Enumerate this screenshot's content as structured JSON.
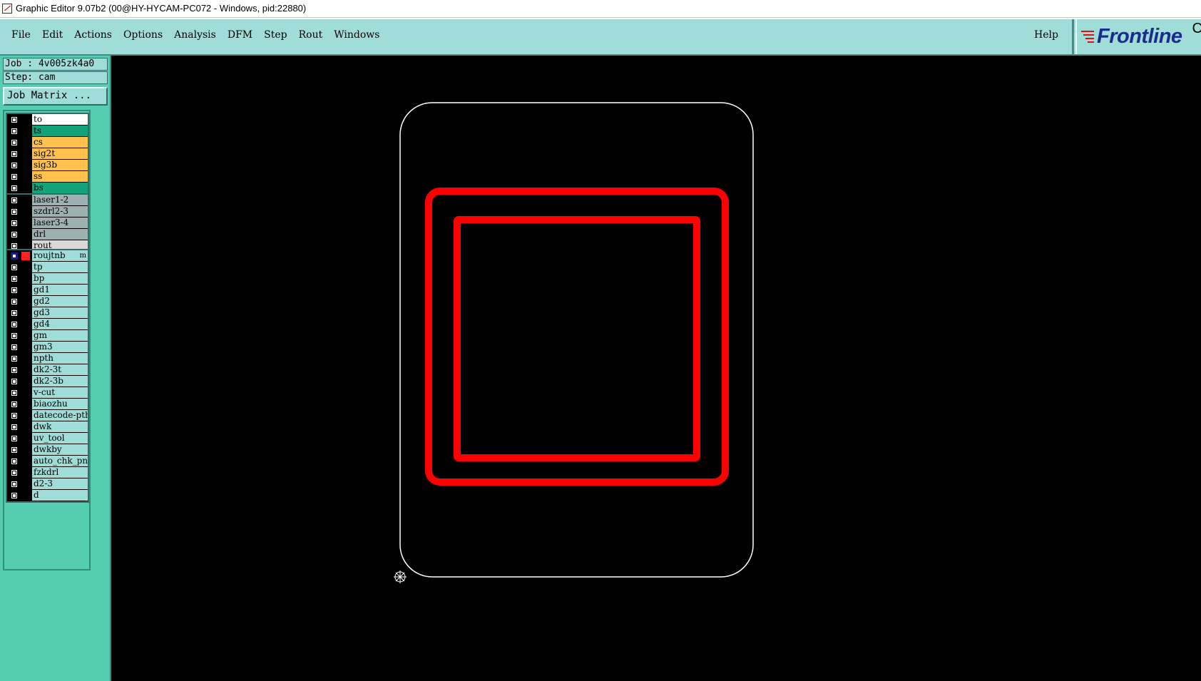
{
  "titlebar": {
    "title": "Graphic Editor 9.07b2 (00@HY-HYCAM-PC072 - Windows, pid:22880)"
  },
  "menubar": {
    "items": [
      {
        "label": "File"
      },
      {
        "label": "Edit"
      },
      {
        "label": "Actions"
      },
      {
        "label": "Options"
      },
      {
        "label": "Analysis"
      },
      {
        "label": "DFM"
      },
      {
        "label": "Step"
      },
      {
        "label": "Rout"
      },
      {
        "label": "Windows"
      }
    ],
    "help": "Help",
    "logo": "Frontline",
    "logo_trailing": "C"
  },
  "sidebar": {
    "job": "Job : 4v005zk4a0",
    "step": "Step: cam",
    "job_matrix": "Job Matrix ..."
  },
  "layers": {
    "group1": [
      {
        "name": "to",
        "color": "#ffffff"
      },
      {
        "name": "ts",
        "color": "#12a37a"
      },
      {
        "name": "cs",
        "color": "#ffc14d"
      },
      {
        "name": "sig2t",
        "color": "#ffc14d"
      },
      {
        "name": "sig3b",
        "color": "#ffc14d"
      },
      {
        "name": "ss",
        "color": "#ffc14d"
      },
      {
        "name": "bs",
        "color": "#12a37a"
      }
    ],
    "group2": [
      {
        "name": "laser1-2",
        "color": "#9fb0b3"
      },
      {
        "name": "szdrl2-3",
        "color": "#9fb0b3"
      },
      {
        "name": "laser3-4",
        "color": "#9fb0b3"
      },
      {
        "name": "drl",
        "color": "#9fb0b3"
      },
      {
        "name": "rout",
        "color": "#d9d9d9"
      }
    ],
    "group3": [
      {
        "name": "roujtnb",
        "color": "#a0dcd8",
        "selected": true,
        "mark": "m"
      },
      {
        "name": "tp",
        "color": "#a0dcd8"
      },
      {
        "name": "bp",
        "color": "#a0dcd8"
      },
      {
        "name": "gd1",
        "color": "#a0dcd8"
      },
      {
        "name": "gd2",
        "color": "#a0dcd8"
      },
      {
        "name": "gd3",
        "color": "#a0dcd8"
      },
      {
        "name": "gd4",
        "color": "#a0dcd8"
      },
      {
        "name": "gm",
        "color": "#a0dcd8"
      },
      {
        "name": "gm3",
        "color": "#a0dcd8"
      },
      {
        "name": "npth",
        "color": "#a0dcd8"
      },
      {
        "name": "dk2-3t",
        "color": "#a0dcd8"
      },
      {
        "name": "dk2-3b",
        "color": "#a0dcd8"
      },
      {
        "name": "v-cut",
        "color": "#a0dcd8"
      },
      {
        "name": "biaozhu",
        "color": "#a0dcd8"
      },
      {
        "name": "datecode-pth",
        "color": "#a0dcd8"
      },
      {
        "name": "dwk",
        "color": "#a0dcd8"
      },
      {
        "name": "uv_tool",
        "color": "#a0dcd8"
      },
      {
        "name": "dwkby",
        "color": "#a0dcd8"
      },
      {
        "name": "auto_chk_pnl",
        "color": "#a0dcd8"
      },
      {
        "name": "fzkdrl",
        "color": "#a0dcd8"
      },
      {
        "name": "d2-3",
        "color": "#a0dcd8"
      },
      {
        "name": "d",
        "color": "#a0dcd8"
      }
    ]
  },
  "colors": {
    "menubar_bg": "#a0dcd8",
    "sidebar_bg": "#54cdb0",
    "canvas_bg": "#000000",
    "profile_outline": "#ffffff",
    "feature_color": "#ff0000",
    "logo_color": "#1a2d8f"
  }
}
